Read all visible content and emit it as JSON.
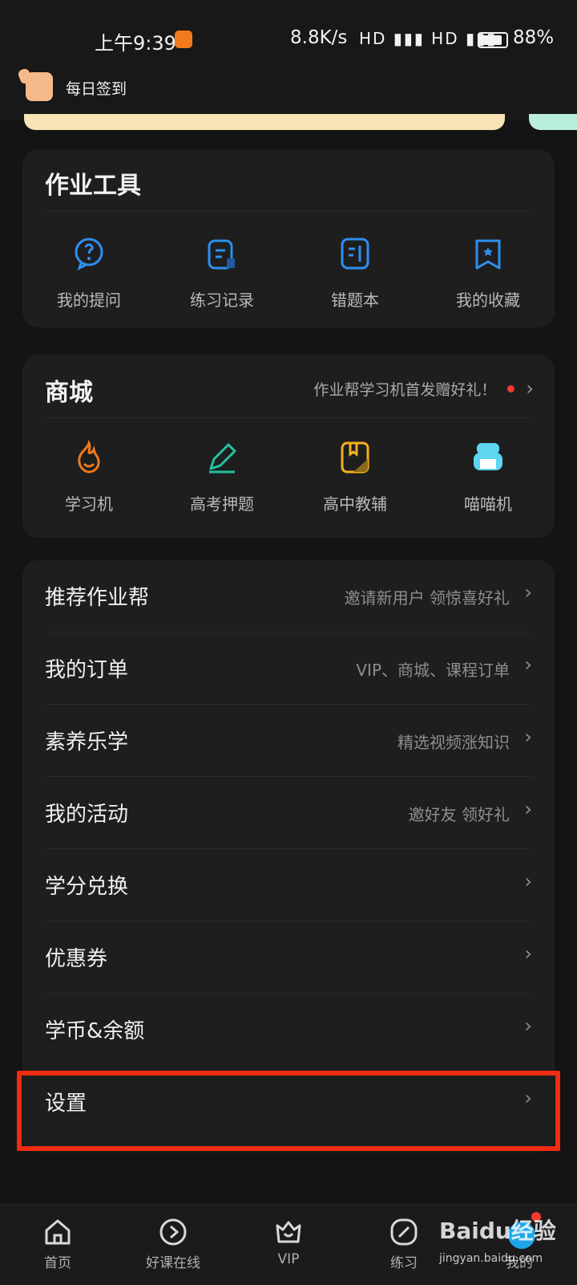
{
  "status_bar": {
    "time": "上午9:39",
    "speed": "8.8K/s",
    "signal": "HD ▮▮▮ HD ▮▮▮",
    "battery": "88%"
  },
  "checkin": {
    "label": "每日签到"
  },
  "homework_tools": {
    "title": "作业工具",
    "items": [
      {
        "label": "我的提问",
        "icon": "question-bubble-icon"
      },
      {
        "label": "练习记录",
        "icon": "document-icon"
      },
      {
        "label": "错题本",
        "icon": "notebook-icon"
      },
      {
        "label": "我的收藏",
        "icon": "bookmark-star-icon"
      }
    ]
  },
  "mall": {
    "title": "商城",
    "promo": "作业帮学习机首发赠好礼！",
    "items": [
      {
        "label": "学习机",
        "icon": "flame-icon"
      },
      {
        "label": "高考押题",
        "icon": "pencil-icon"
      },
      {
        "label": "高中教辅",
        "icon": "book-icon"
      },
      {
        "label": "喵喵机",
        "icon": "printer-icon"
      }
    ]
  },
  "menu": [
    {
      "title": "推荐作业帮",
      "subtitle": "邀请新用户 领惊喜好礼"
    },
    {
      "title": "我的订单",
      "subtitle": "VIP、商城、课程订单"
    },
    {
      "title": "素养乐学",
      "subtitle": "精选视频涨知识"
    },
    {
      "title": "我的活动",
      "subtitle": "邀好友 领好礼"
    },
    {
      "title": "学分兑换",
      "subtitle": ""
    },
    {
      "title": "优惠券",
      "subtitle": ""
    },
    {
      "title": "学币&余额",
      "subtitle": ""
    },
    {
      "title": "设置",
      "subtitle": ""
    }
  ],
  "tabs": [
    {
      "label": "首页",
      "icon": "home-icon"
    },
    {
      "label": "好课在线",
      "icon": "play-circle-icon"
    },
    {
      "label": "VIP",
      "icon": "vip-crown-icon"
    },
    {
      "label": "练习",
      "icon": "compass-icon"
    },
    {
      "label": "我的",
      "icon": "avatar-icon"
    }
  ],
  "watermark": {
    "logo": "Baidu经验",
    "url": "jingyan.baidu.com"
  },
  "colors": {
    "background": "#141414",
    "card": "#1e1e1e",
    "accent_blue": "#2f8ff0",
    "highlight_red": "#ee2d10"
  }
}
